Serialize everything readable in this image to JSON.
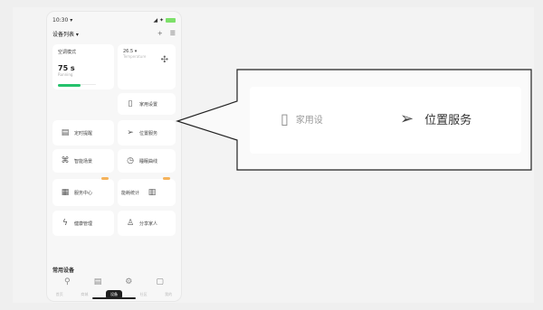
{
  "status_bar": {
    "time": "10:30 ▾",
    "signal": "◢ ✦"
  },
  "header": {
    "title": "设备列表 ▾",
    "add_icon": "plus-icon",
    "more_icon": "menu-icon"
  },
  "summary": {
    "left_label": "空调模式",
    "left_value": "75 s",
    "left_sub": "Running",
    "progress_fraction": 0.6,
    "right_label": "26.5 ▾",
    "right_sub": "Temperature"
  },
  "features": [
    {
      "icon": "schedule-icon",
      "label": "定时提醒"
    },
    {
      "icon": "phone-icon",
      "label": "家用设置"
    },
    {
      "icon": "location-icon",
      "label": "位置服务"
    },
    {
      "icon": "scene-icon",
      "label": "智能场景"
    },
    {
      "icon": "timer-icon",
      "label": "睡眠曲线"
    },
    {
      "icon": "store-icon",
      "label": "服务中心"
    },
    {
      "icon": "energy-icon",
      "label": "能耗统计"
    },
    {
      "icon": "bolt-icon",
      "label": "健康管理"
    },
    {
      "icon": "user-icon",
      "label": "分享家人"
    }
  ],
  "section_title": "常用设备",
  "bottom_icons": [
    "device-icon",
    "doc-icon",
    "gear-icon",
    "box-icon"
  ],
  "tabbar": [
    "首页",
    "商城",
    "设备",
    "社区",
    "我的"
  ],
  "zoom": {
    "left_label": "家用设",
    "right_label": "位置服务"
  }
}
